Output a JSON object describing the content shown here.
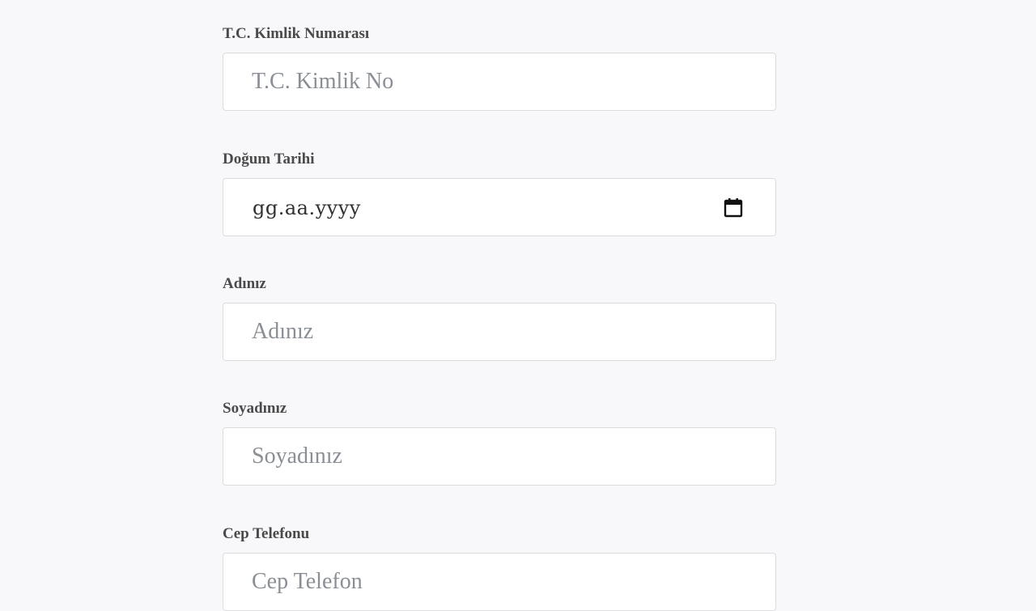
{
  "form": {
    "tc": {
      "label": "T.C. Kimlik Numarası",
      "placeholder": "T.C. Kimlik No"
    },
    "birth": {
      "label": "Doğum Tarihi",
      "placeholder": "gg.aa.yyyy",
      "icon": "calendar-icon"
    },
    "name": {
      "label": "Adınız",
      "placeholder": "Adınız"
    },
    "surname": {
      "label": "Soyadınız",
      "placeholder": "Soyadınız"
    },
    "phone": {
      "label": "Cep Telefonu",
      "placeholder": "Cep Telefon"
    }
  }
}
